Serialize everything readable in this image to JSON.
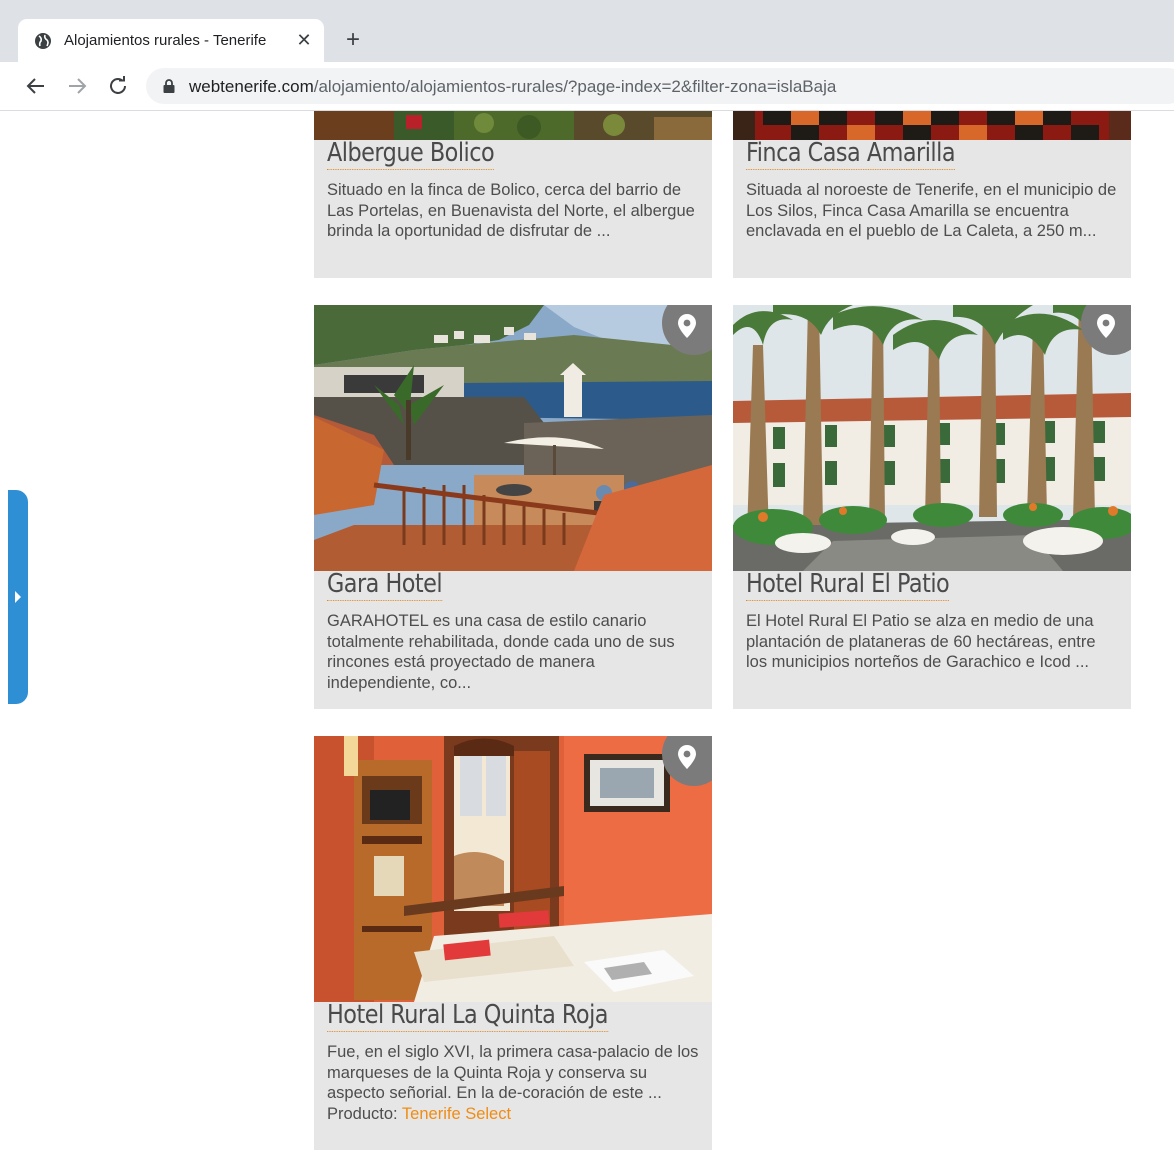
{
  "browser": {
    "tab_title": "Alojamientos rurales - Tenerife",
    "url_host": "webtenerife.com",
    "url_path": "/alojamiento/alojamientos-rurales/?page-index=2&filter-zona=islaBaja"
  },
  "cards": [
    {
      "title": "Albergue Bolico",
      "description": "Situado en la finca de Bolico, cerca del barrio de Las Portelas, en Buenavista del Norte, el albergue brinda la oportunidad de disfrutar de ..."
    },
    {
      "title": "Finca Casa Amarilla",
      "description": "Situada al noroeste de Tenerife, en el municipio de Los Silos, Finca Casa Amarilla se encuentra enclavada en el pueblo de La Caleta, a 250 m..."
    },
    {
      "title": "Gara Hotel",
      "description": "GARAHOTEL es  una casa de estilo canario totalmente rehabilitada, donde cada uno de sus rincones está proyectado de manera independiente, co..."
    },
    {
      "title": "Hotel Rural El Patio",
      "description": "El Hotel Rural El Patio se alza en medio de una plantación de plataneras de 60 hectáreas, entre los municipios norteños de Garachico e Icod ..."
    },
    {
      "title": "Hotel Rural La Quinta Roja",
      "description": "Fue, en el siglo XVI, la primera casa-palacio de los marqueses de la Quinta Roja y conserva su aspecto señorial. En la de-coración de este ...",
      "product_label": "Producto: ",
      "product_link": "Tenerife Select"
    }
  ]
}
